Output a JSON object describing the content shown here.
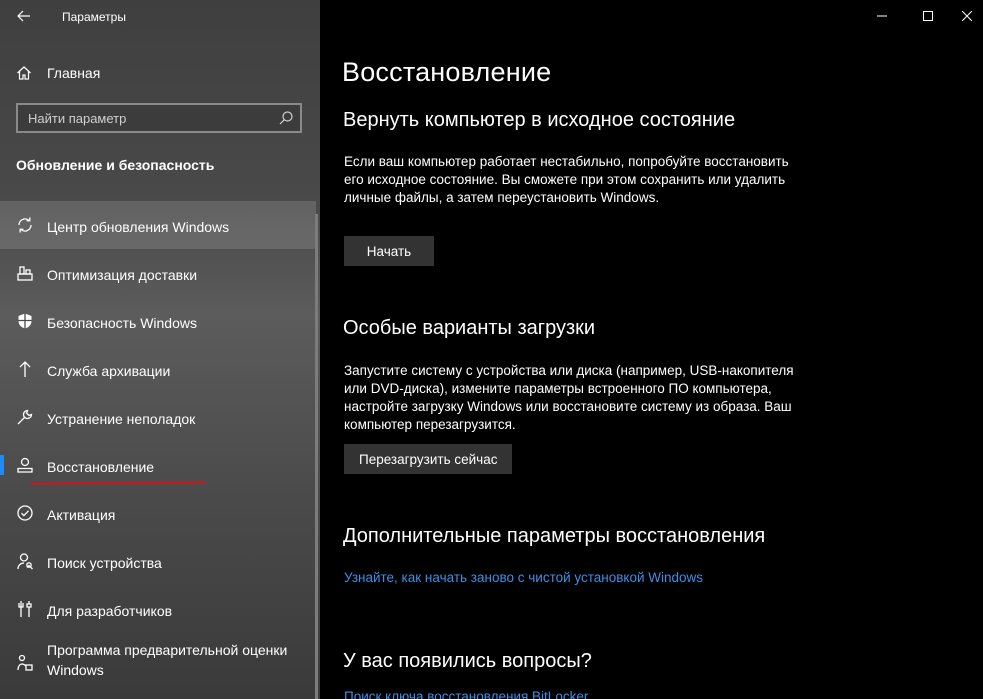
{
  "app": {
    "title": "Параметры"
  },
  "sidebar": {
    "home_label": "Главная",
    "search_placeholder": "Найти параметр",
    "section_title": "Обновление и безопасность",
    "items": [
      {
        "label": "Центр обновления Windows",
        "icon": "sync-icon"
      },
      {
        "label": "Оптимизация доставки",
        "icon": "delivery-icon"
      },
      {
        "label": "Безопасность Windows",
        "icon": "shield-icon"
      },
      {
        "label": "Служба архивации",
        "icon": "backup-arrow-icon"
      },
      {
        "label": "Устранение неполадок",
        "icon": "wrench-icon"
      },
      {
        "label": "Восстановление",
        "icon": "recovery-icon",
        "selected": true
      },
      {
        "label": "Активация",
        "icon": "check-circle-icon"
      },
      {
        "label": "Поиск устройства",
        "icon": "person-search-icon"
      },
      {
        "label": "Для разработчиков",
        "icon": "dev-tools-icon"
      },
      {
        "label": "Программа предварительной оценки Windows",
        "icon": "insider-icon"
      }
    ]
  },
  "main": {
    "page_title": "Восстановление",
    "reset": {
      "heading": "Вернуть компьютер в исходное состояние",
      "description": "Если ваш компьютер работает нестабильно, попробуйте восстановить его исходное состояние. Вы сможете при этом сохранить или удалить личные файлы, а затем переустановить Windows.",
      "button": "Начать"
    },
    "advanced_startup": {
      "heading": "Особые варианты загрузки",
      "description": "Запустите систему с устройства или диска (например, USB-накопителя или DVD-диска), измените параметры встроенного ПО компьютера, настройте загрузку Windows или восстановите систему из образа. Ваш компьютер перезагрузится.",
      "button": "Перезагрузить сейчас"
    },
    "more_options": {
      "heading": "Дополнительные параметры восстановления",
      "link": "Узнайте, как начать заново с чистой установкой Windows"
    },
    "questions": {
      "heading": "У вас появились вопросы?",
      "link": "Поиск ключа восстановления BitLocker"
    }
  },
  "colors": {
    "accent": "#1a8cff",
    "link": "#3d8fe6",
    "annotation_underline": "#d0151b",
    "button_bg": "#333333"
  }
}
